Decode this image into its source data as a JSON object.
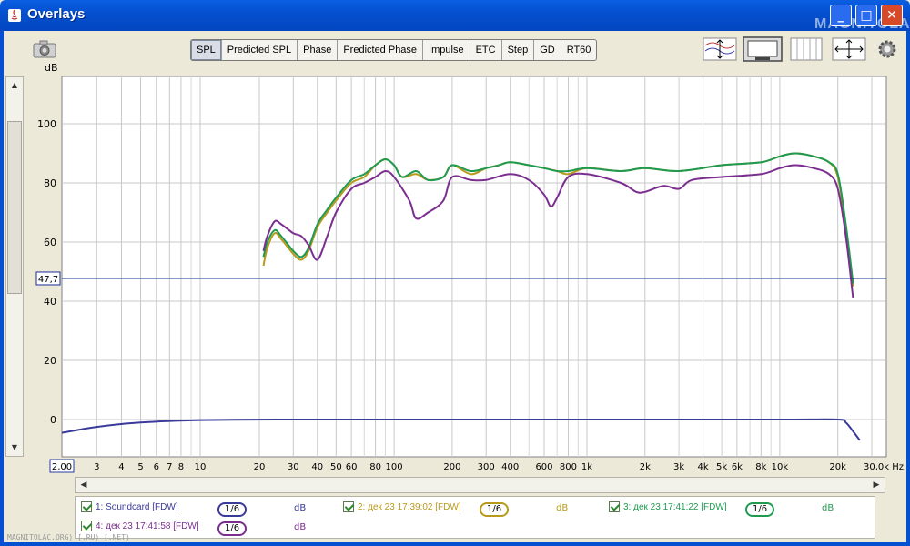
{
  "window": {
    "title": "Overlays"
  },
  "watermark": {
    "logo": "MAGNITOLA",
    "footer": "MAGNITOLAC.ORG) [.RU) [.NET)"
  },
  "tabs": [
    {
      "label": "SPL",
      "active": true
    },
    {
      "label": "Predicted SPL",
      "active": false
    },
    {
      "label": "Phase",
      "active": false
    },
    {
      "label": "Predicted Phase",
      "active": false
    },
    {
      "label": "Impulse",
      "active": false
    },
    {
      "label": "ETC",
      "active": false
    },
    {
      "label": "Step",
      "active": false
    },
    {
      "label": "GD",
      "active": false
    },
    {
      "label": "RT60",
      "active": false
    }
  ],
  "chart_data": {
    "type": "line",
    "ylabel": "dB",
    "xscale": "log",
    "xlim": [
      20,
      30000
    ],
    "ylim": [
      -10,
      115
    ],
    "yticks": [
      0,
      20,
      40,
      60,
      80,
      100
    ],
    "xticks": [
      {
        "v": 2,
        "label": "2,00"
      },
      {
        "v": 3,
        "label": "3"
      },
      {
        "v": 4,
        "label": "4"
      },
      {
        "v": 5,
        "label": "5"
      },
      {
        "v": 6,
        "label": "6"
      },
      {
        "v": 7,
        "label": "7"
      },
      {
        "v": 8,
        "label": "8"
      },
      {
        "v": 10,
        "label": "10"
      },
      {
        "v": 20,
        "label": "20"
      },
      {
        "v": 30,
        "label": "30"
      },
      {
        "v": 40,
        "label": "40"
      },
      {
        "v": 50,
        "label": "50"
      },
      {
        "v": 60,
        "label": "60"
      },
      {
        "v": 80,
        "label": "80"
      },
      {
        "v": 100,
        "label": "100"
      },
      {
        "v": 200,
        "label": "200"
      },
      {
        "v": 300,
        "label": "300"
      },
      {
        "v": 400,
        "label": "400"
      },
      {
        "v": 600,
        "label": "600"
      },
      {
        "v": 800,
        "label": "800"
      },
      {
        "v": 1000,
        "label": "1k"
      },
      {
        "v": 2000,
        "label": "2k"
      },
      {
        "v": 3000,
        "label": "3k"
      },
      {
        "v": 4000,
        "label": "4k"
      },
      {
        "v": 5000,
        "label": "5k"
      },
      {
        "v": 6000,
        "label": "6k"
      },
      {
        "v": 8000,
        "label": "8k"
      },
      {
        "v": 10000,
        "label": "10k"
      },
      {
        "v": 20000,
        "label": "20k"
      },
      {
        "v": 30000,
        "label": "30,0k Hz"
      }
    ],
    "cursor_y": {
      "value": 47.7,
      "label": "47,7"
    },
    "series": [
      {
        "name": "1: Soundcard [FDW]",
        "color": "#3a3a9a",
        "smoothing": "1/6",
        "unit": "dB",
        "points": [
          [
            2,
            -4.5
          ],
          [
            3,
            -2.5
          ],
          [
            5,
            -1
          ],
          [
            10,
            -0.2
          ],
          [
            30,
            0
          ],
          [
            100,
            0
          ],
          [
            1000,
            0
          ],
          [
            10000,
            0
          ],
          [
            20000,
            0
          ],
          [
            22000,
            -1
          ],
          [
            24000,
            -4
          ],
          [
            26000,
            -7
          ]
        ]
      },
      {
        "name": "2: дек 23 17:39:02 [FDW]",
        "color": "#b89a1c",
        "smoothing": "1/6",
        "unit": "dB",
        "points": [
          [
            21,
            52
          ],
          [
            22,
            58
          ],
          [
            24,
            63
          ],
          [
            26,
            61
          ],
          [
            30,
            56
          ],
          [
            33,
            54
          ],
          [
            36,
            57
          ],
          [
            40,
            65
          ],
          [
            45,
            70
          ],
          [
            50,
            74
          ],
          [
            60,
            80
          ],
          [
            70,
            82
          ],
          [
            80,
            86
          ],
          [
            90,
            88
          ],
          [
            100,
            86
          ],
          [
            110,
            82
          ],
          [
            130,
            83
          ],
          [
            150,
            81
          ],
          [
            180,
            82
          ],
          [
            200,
            86
          ],
          [
            250,
            83
          ],
          [
            300,
            85
          ],
          [
            350,
            86
          ],
          [
            400,
            87
          ],
          [
            500,
            86
          ],
          [
            600,
            85
          ],
          [
            700,
            84
          ],
          [
            800,
            83
          ],
          [
            1000,
            85
          ],
          [
            1500,
            84
          ],
          [
            2000,
            85
          ],
          [
            3000,
            84
          ],
          [
            5000,
            86
          ],
          [
            8000,
            87
          ],
          [
            10000,
            89
          ],
          [
            12000,
            90
          ],
          [
            15000,
            89
          ],
          [
            18000,
            87
          ],
          [
            20000,
            82
          ],
          [
            22000,
            65
          ],
          [
            24000,
            45
          ]
        ]
      },
      {
        "name": "3: дек 23 17:41:22 [FDW]",
        "color": "#1f9a50",
        "smoothing": "1/6",
        "unit": "dB",
        "points": [
          [
            21,
            55
          ],
          [
            22,
            60
          ],
          [
            24,
            64
          ],
          [
            26,
            62
          ],
          [
            30,
            57
          ],
          [
            33,
            55
          ],
          [
            36,
            58
          ],
          [
            40,
            66
          ],
          [
            45,
            71
          ],
          [
            50,
            75
          ],
          [
            60,
            81
          ],
          [
            70,
            83
          ],
          [
            80,
            86
          ],
          [
            90,
            88
          ],
          [
            100,
            86
          ],
          [
            110,
            82
          ],
          [
            130,
            84
          ],
          [
            150,
            81
          ],
          [
            180,
            82
          ],
          [
            200,
            86
          ],
          [
            250,
            84
          ],
          [
            300,
            85
          ],
          [
            350,
            86
          ],
          [
            400,
            87
          ],
          [
            500,
            86
          ],
          [
            600,
            85
          ],
          [
            700,
            84
          ],
          [
            800,
            84
          ],
          [
            1000,
            85
          ],
          [
            1500,
            84
          ],
          [
            2000,
            85
          ],
          [
            3000,
            84
          ],
          [
            5000,
            86
          ],
          [
            8000,
            87
          ],
          [
            10000,
            89
          ],
          [
            12000,
            90
          ],
          [
            15000,
            89
          ],
          [
            18000,
            87
          ],
          [
            20000,
            83
          ],
          [
            22000,
            66
          ],
          [
            24000,
            46
          ]
        ]
      },
      {
        "name": "4: дек 23 17:41:58 [FDW]",
        "color": "#7b2e90",
        "smoothing": "1/6",
        "unit": "dB",
        "points": [
          [
            21,
            57
          ],
          [
            22,
            62
          ],
          [
            24,
            67
          ],
          [
            26,
            66
          ],
          [
            30,
            63
          ],
          [
            33,
            62
          ],
          [
            36,
            59
          ],
          [
            40,
            54
          ],
          [
            45,
            62
          ],
          [
            50,
            70
          ],
          [
            60,
            78
          ],
          [
            70,
            80
          ],
          [
            80,
            82
          ],
          [
            90,
            84
          ],
          [
            100,
            82
          ],
          [
            120,
            74
          ],
          [
            130,
            68
          ],
          [
            150,
            70
          ],
          [
            180,
            74
          ],
          [
            200,
            82
          ],
          [
            250,
            81
          ],
          [
            300,
            81
          ],
          [
            400,
            83
          ],
          [
            500,
            81
          ],
          [
            600,
            76
          ],
          [
            650,
            72
          ],
          [
            700,
            75
          ],
          [
            800,
            82
          ],
          [
            1000,
            83
          ],
          [
            1500,
            80
          ],
          [
            1800,
            77
          ],
          [
            2000,
            77
          ],
          [
            2500,
            79
          ],
          [
            3000,
            78
          ],
          [
            3500,
            81
          ],
          [
            5000,
            82
          ],
          [
            8000,
            83
          ],
          [
            10000,
            85
          ],
          [
            12000,
            86
          ],
          [
            15000,
            85
          ],
          [
            18000,
            83
          ],
          [
            20000,
            78
          ],
          [
            22000,
            62
          ],
          [
            24000,
            41
          ]
        ]
      }
    ]
  }
}
